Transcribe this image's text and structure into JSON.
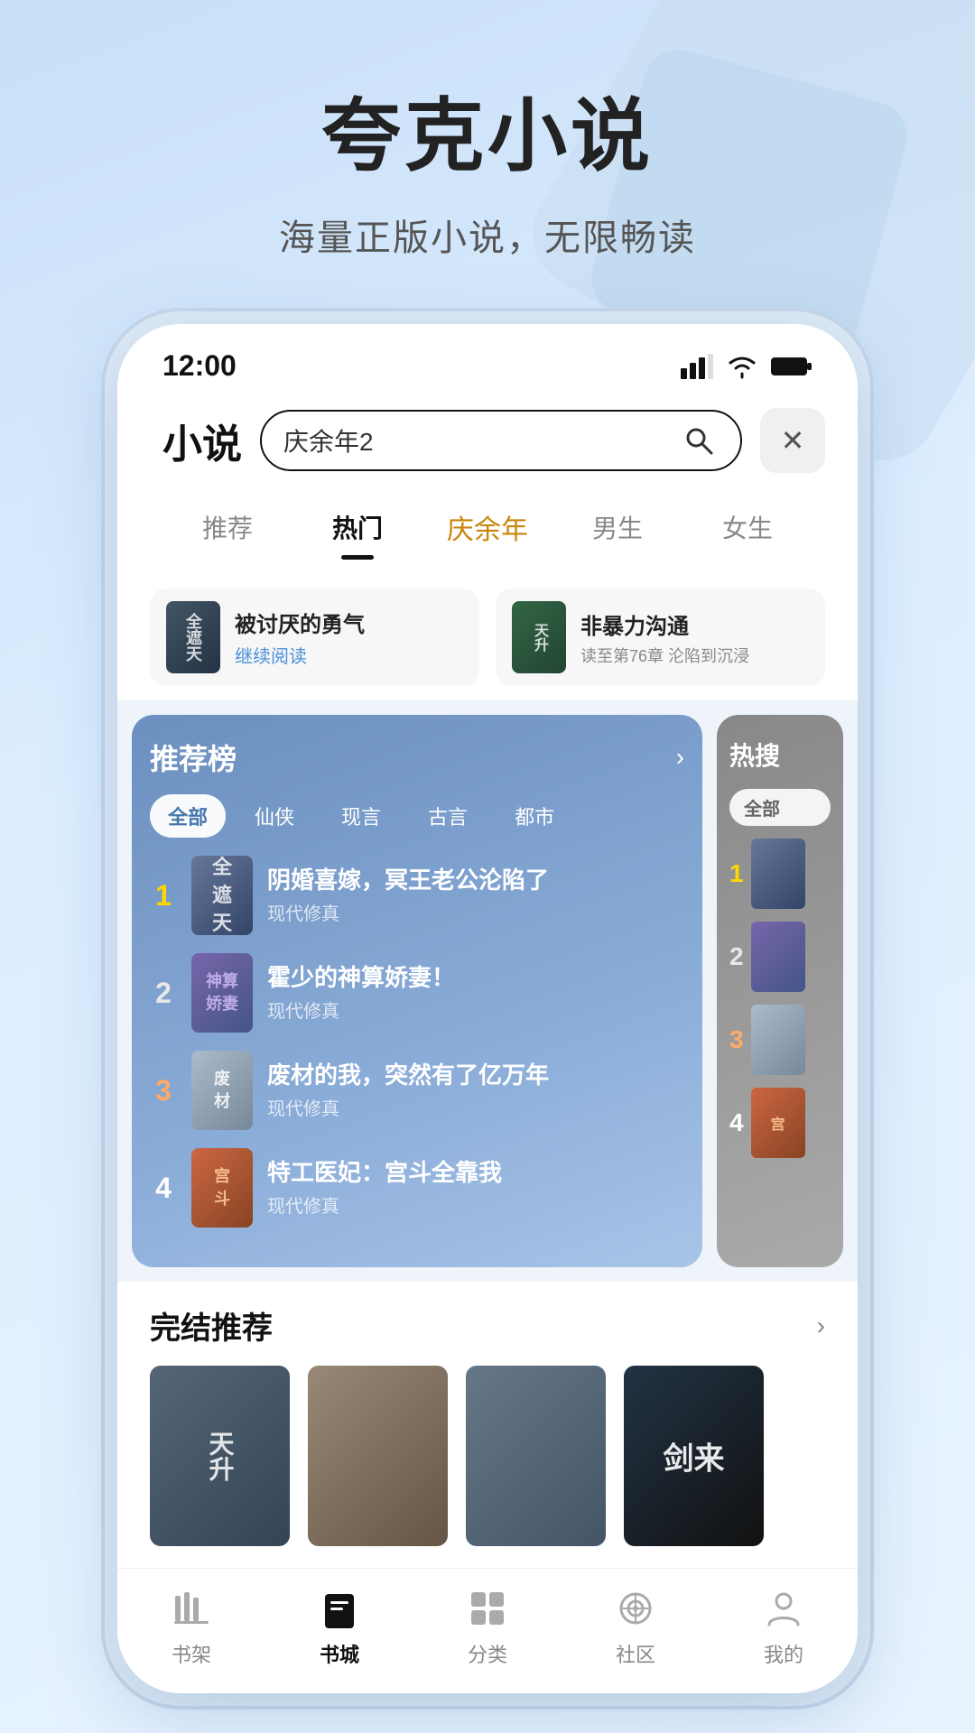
{
  "app": {
    "title": "夸克小说",
    "subtitle": "海量正版小说，无限畅读"
  },
  "status_bar": {
    "time": "12:00"
  },
  "top_bar": {
    "section_title": "小说",
    "search_placeholder": "庆余年2",
    "close_label": "×"
  },
  "nav_tabs": [
    {
      "label": "推荐",
      "active": false,
      "special": false
    },
    {
      "label": "热门",
      "active": true,
      "special": false
    },
    {
      "label": "余年",
      "active": false,
      "special": true
    },
    {
      "label": "男生",
      "active": false,
      "special": false
    },
    {
      "label": "女生",
      "active": false,
      "special": false
    }
  ],
  "reading_cards": [
    {
      "title": "被讨厌的勇气",
      "status": "继续阅读",
      "progress": ""
    },
    {
      "title": "非暴力沟通",
      "status": "",
      "progress": "读至第76章 沦陷到沉浸"
    }
  ],
  "ranking": {
    "heading": "推荐榜",
    "arrow": "›",
    "categories": [
      "全部",
      "仙侠",
      "现言",
      "古言",
      "都市"
    ],
    "active_category": "全部",
    "items": [
      {
        "rank": "1",
        "title": "阴婚喜嫁，冥王老公沦陷了",
        "genre": "现代修真"
      },
      {
        "rank": "2",
        "title": "霍少的神算娇妻！",
        "genre": "现代修真"
      },
      {
        "rank": "3",
        "title": "废材的我，突然有了亿万年",
        "genre": "现代修真"
      },
      {
        "rank": "4",
        "title": "特工医妃：宫斗全靠我",
        "genre": "现代修真"
      }
    ]
  },
  "hot_search": {
    "heading": "热搜",
    "active_category": "全部"
  },
  "completed": {
    "heading": "完结推荐",
    "arrow": "›",
    "books": [
      {
        "title": "天",
        "cover_hint": "天升"
      },
      {
        "title": "",
        "cover_hint": ""
      },
      {
        "title": "",
        "cover_hint": ""
      },
      {
        "title": "剑来",
        "cover_hint": "剑来"
      }
    ]
  },
  "bottom_nav": [
    {
      "label": "书架",
      "active": false,
      "icon": "bookshelf"
    },
    {
      "label": "书城",
      "active": true,
      "icon": "book"
    },
    {
      "label": "分类",
      "active": false,
      "icon": "grid"
    },
    {
      "label": "社区",
      "active": false,
      "icon": "community"
    },
    {
      "label": "我的",
      "active": false,
      "icon": "profile"
    }
  ]
}
